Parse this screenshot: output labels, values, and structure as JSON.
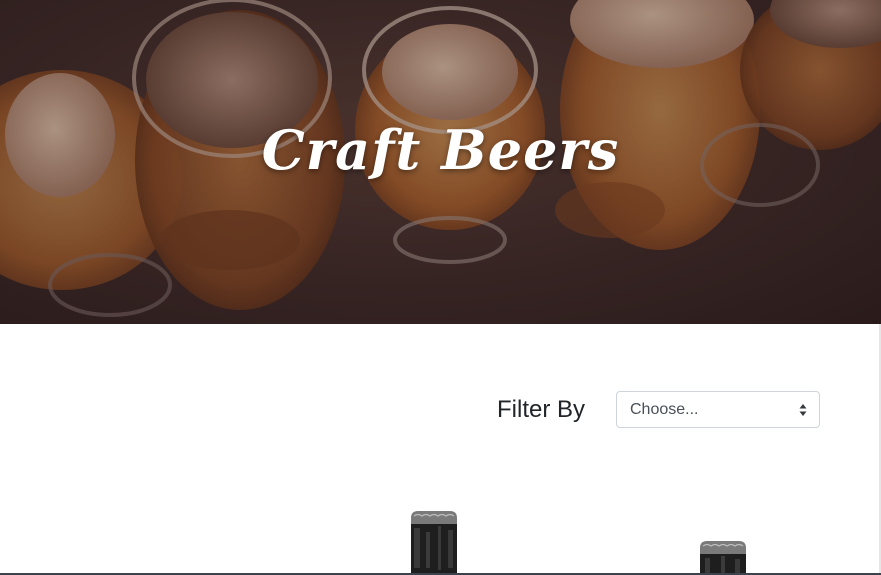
{
  "hero": {
    "title": "Craft Beers"
  },
  "filter": {
    "label": "Filter By",
    "selected": "Choose..."
  },
  "colors": {
    "hero_dark": "#3c2a28",
    "beer_amber": "#c97a3a",
    "foam": "#e8c4a8",
    "label_text": "#212529",
    "select_border": "#ced4da"
  },
  "icons": {
    "select_arrows": "updown-chevron-icon"
  }
}
